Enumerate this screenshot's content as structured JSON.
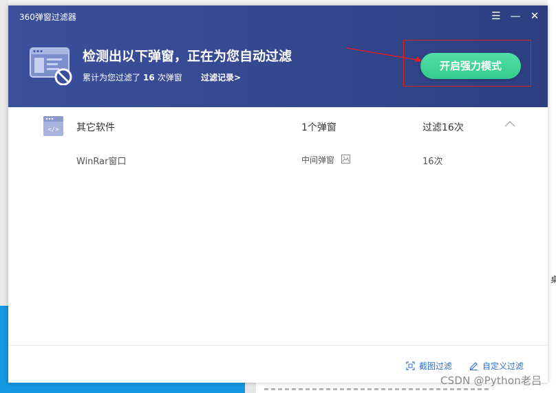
{
  "window": {
    "title": "360弹窗过滤器",
    "controls": {
      "menu": "☰",
      "minimize": "—",
      "close": "✕"
    }
  },
  "header": {
    "headline": "检测出以下弹窗，正在为您自动过滤",
    "subline_prefix": "累计为您过滤了",
    "filtered_count": "16",
    "subline_suffix": "次弹窗",
    "history_link": "过滤记录>",
    "power_mode_button": "开启强力模式",
    "colors": {
      "header_bg": "#3a4d98",
      "button_green": "#3fd497",
      "highlight_red": "#e02020"
    }
  },
  "list": {
    "groups": [
      {
        "name": "其它软件",
        "count_label": "1个弹窗",
        "filter_label": "过滤16次",
        "icon": "code-window-icon",
        "expanded": true,
        "items": [
          {
            "name": "WinRar窗口",
            "type": "中间弹窗",
            "count": "16次"
          }
        ]
      }
    ]
  },
  "footer": {
    "screenshot_filter": "截图过滤",
    "custom_filter": "自定义过滤",
    "link_color": "#2e6fd8"
  },
  "background": {
    "right_edge_char": "桌",
    "watermark": "CSDN @Python老吕"
  }
}
